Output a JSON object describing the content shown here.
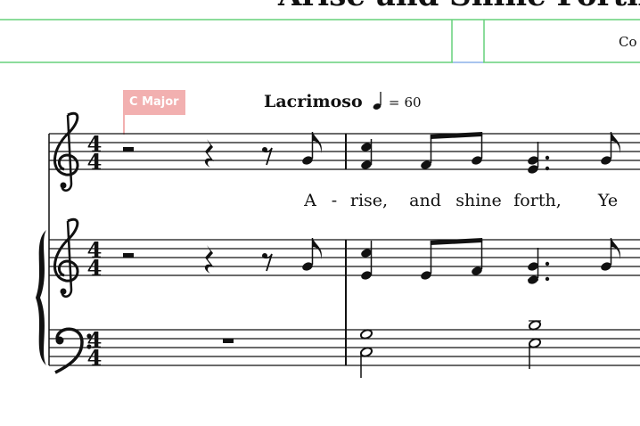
{
  "score": {
    "title": "Arise and Shine Forth",
    "composer": "Co",
    "key_signature": "C Major",
    "tempo_text": "Lacrimoso",
    "tempo_equals": "=",
    "tempo_bpm": "60",
    "time_signature": {
      "top": "4",
      "bottom": "4"
    },
    "lyrics": [
      "A",
      "-",
      "rise,",
      "and",
      "shine",
      "forth,",
      "Ye"
    ]
  },
  "colors": {
    "frame_border": "#66d07a",
    "frame_highlight": "#a8c4ee",
    "key_flag": "#f2b0b0",
    "ink": "#111111"
  },
  "icons": [
    "treble-clef-icon",
    "bass-clef-icon",
    "quarter-note-icon",
    "brace-icon"
  ]
}
